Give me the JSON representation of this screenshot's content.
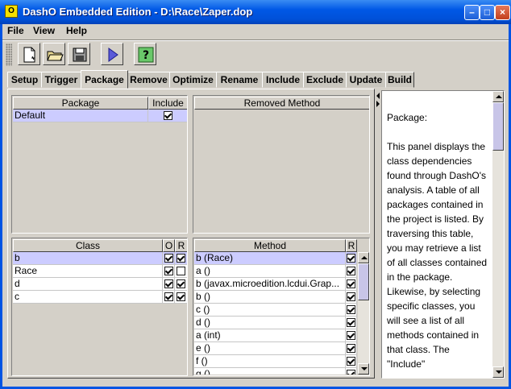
{
  "window": {
    "title": "DashO Embedded Edition - D:\\Race\\Zaper.dop",
    "icon_letter": "O"
  },
  "menus": [
    "File",
    "View",
    "Help"
  ],
  "tabs": [
    "Setup",
    "Trigger",
    "Package",
    "Remove",
    "Optimize",
    "Rename",
    "Include",
    "Exclude",
    "Update",
    "Build"
  ],
  "active_tab": "Package",
  "package_table": {
    "headers": [
      "Package",
      "Include"
    ],
    "rows": [
      {
        "name": "Default",
        "include": true,
        "selected": true
      }
    ]
  },
  "removed_method_table": {
    "headers": [
      "Removed Method"
    ],
    "rows": []
  },
  "class_table": {
    "headers": [
      "Class",
      "O",
      "R"
    ],
    "rows": [
      {
        "name": "b",
        "o": true,
        "r": true,
        "selected": true
      },
      {
        "name": "Race",
        "o": true,
        "r": false,
        "selected": false
      },
      {
        "name": "d",
        "o": true,
        "r": true,
        "selected": false
      },
      {
        "name": "c",
        "o": true,
        "r": true,
        "selected": false
      }
    ]
  },
  "method_table": {
    "headers": [
      "Method",
      "R"
    ],
    "rows": [
      {
        "name": "b (Race)",
        "r": true,
        "selected": true
      },
      {
        "name": "a ()",
        "r": true
      },
      {
        "name": "b (javax.microedition.lcdui.Grap...",
        "r": true
      },
      {
        "name": "b ()",
        "r": true
      },
      {
        "name": "c ()",
        "r": true
      },
      {
        "name": "d ()",
        "r": true
      },
      {
        "name": "a (int)",
        "r": true
      },
      {
        "name": "e ()",
        "r": true
      },
      {
        "name": "f ()",
        "r": true
      },
      {
        "name": "g ()",
        "r": true
      }
    ]
  },
  "help": {
    "heading": "Package:",
    "body": "This panel displays the class dependencies found through DashO's analysis. A table of all packages contained in the project is listed. By traversing this table, you may retrieve a list of all classes contained in the package. Likewise, by selecting specific classes, you will see a list of all methods contained in that class. The \"Include\""
  },
  "icons": [
    "new-project-icon",
    "open-folder-icon",
    "save-disk-icon",
    "run-play-icon",
    "help-question-icon"
  ],
  "colors": {
    "titlebar": "#0058e6",
    "selection": "#ccccff",
    "face": "#d4d0c8"
  }
}
